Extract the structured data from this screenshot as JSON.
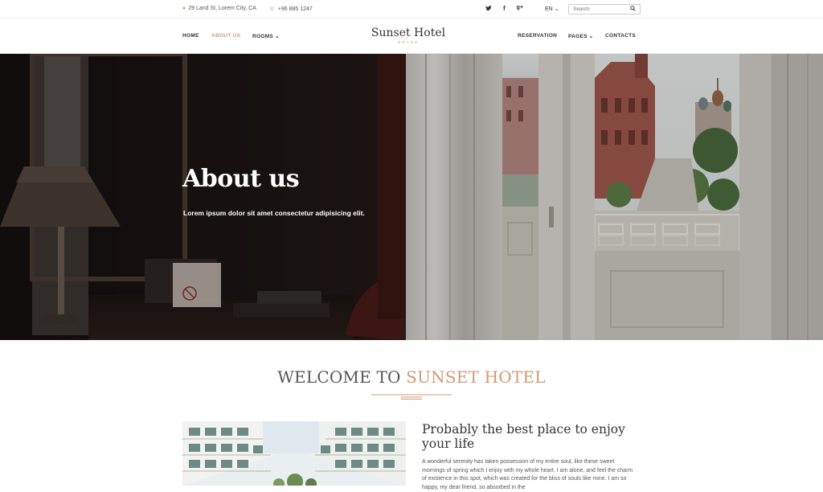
{
  "topbar": {
    "address": "29 Land St, Lorem City, CA",
    "phone": "+96 885 1247",
    "social_icons": [
      "twitter-icon",
      "facebook-icon",
      "google-plus-icon"
    ],
    "language": "EN",
    "search_placeholder": "Search"
  },
  "nav": {
    "left": [
      "HOME",
      "ABOUT US",
      "ROOMS"
    ],
    "right": [
      "RESERVATION",
      "PAGES",
      "CONTACTS"
    ],
    "active": "ABOUT US",
    "accent": "#d09a72"
  },
  "brand": {
    "name": "Sunset Hotel",
    "sub": "GRAND"
  },
  "hero": {
    "title": "About us",
    "subtitle": "Lorem ipsum dolor sit amet consectetur adipisicing elit."
  },
  "welcome": {
    "prefix": "WELCOME TO",
    "accent": "SUNSET HOTEL"
  },
  "about": {
    "heading": "Probably the best place to enjoy your life",
    "text": "A wonderful serenity has taken possession of my entire soul, like these sweet mornings of spring which I enjoy with my whole heart. I am alone, and feel the charm of existence in this spot, which was created for the bliss of souls like mine. I am so happy, my dear friend, so absorbed in the"
  }
}
